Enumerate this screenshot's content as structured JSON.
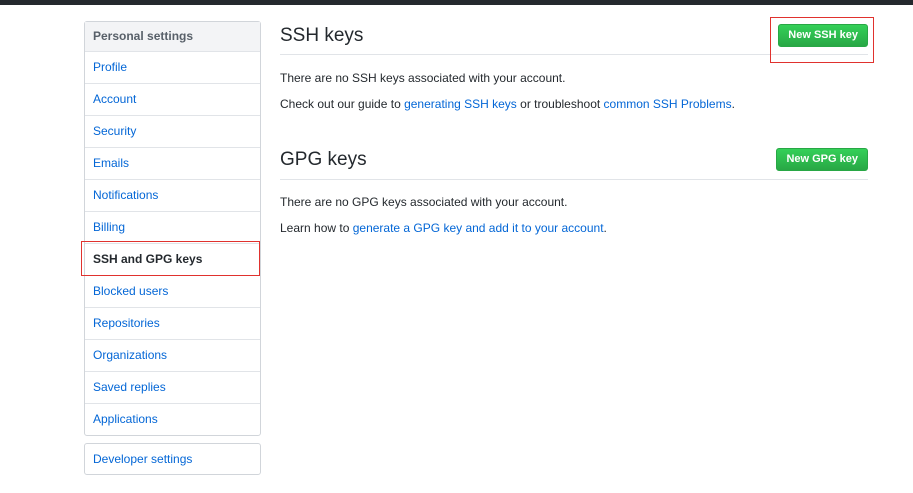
{
  "sidebar": {
    "heading": "Personal settings",
    "items": [
      {
        "label": "Profile"
      },
      {
        "label": "Account"
      },
      {
        "label": "Security"
      },
      {
        "label": "Emails"
      },
      {
        "label": "Notifications"
      },
      {
        "label": "Billing"
      },
      {
        "label": "SSH and GPG keys",
        "selected": true
      },
      {
        "label": "Blocked users"
      },
      {
        "label": "Repositories"
      },
      {
        "label": "Organizations"
      },
      {
        "label": "Saved replies"
      },
      {
        "label": "Applications"
      }
    ],
    "developer_settings": "Developer settings"
  },
  "ssh": {
    "title": "SSH keys",
    "new_button": "New SSH key",
    "empty_text": "There are no SSH keys associated with your account.",
    "guide_prefix": "Check out our guide to ",
    "guide_link": "generating SSH keys",
    "guide_middle": " or troubleshoot ",
    "problems_link": "common SSH Problems",
    "guide_suffix": "."
  },
  "gpg": {
    "title": "GPG keys",
    "new_button": "New GPG key",
    "empty_text": "There are no GPG keys associated with your account.",
    "learn_prefix": "Learn how to ",
    "learn_link": "generate a GPG key and add it to your account",
    "learn_suffix": "."
  },
  "colors": {
    "link": "#0366d6",
    "button_green": "#28a745",
    "highlight_red": "#e0322e",
    "topbar": "#24292e"
  }
}
